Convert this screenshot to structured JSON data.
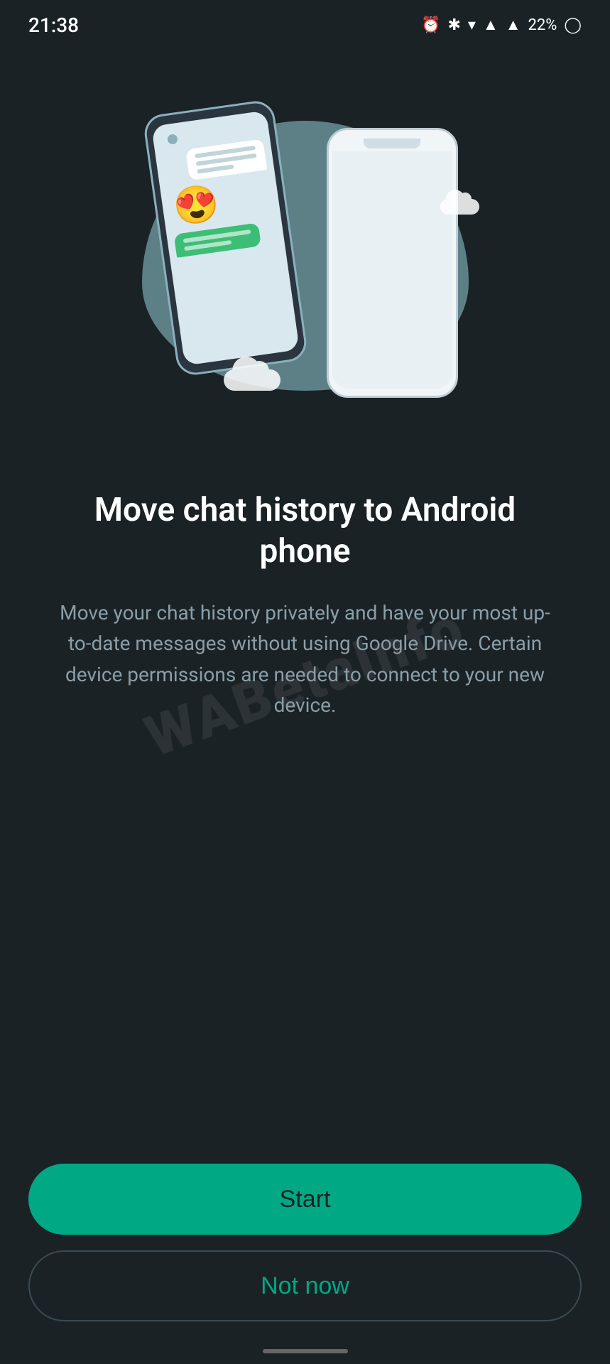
{
  "status_bar": {
    "time": "21:38",
    "battery_percent": "22%"
  },
  "illustration": {
    "alt": "Two phones showing chat history transfer"
  },
  "content": {
    "title": "Move chat history to Android phone",
    "description": "Move your chat history privately and have your most up-to-date messages without using Google Drive. Certain device permissions are needed to connect to your new device."
  },
  "buttons": {
    "start_label": "Start",
    "not_now_label": "Not now"
  },
  "watermark": {
    "text": "WABetaInfo"
  },
  "colors": {
    "background": "#1a2226",
    "accent_green": "#00a884",
    "text_primary": "#ffffff",
    "text_secondary": "#8a9ea8"
  }
}
